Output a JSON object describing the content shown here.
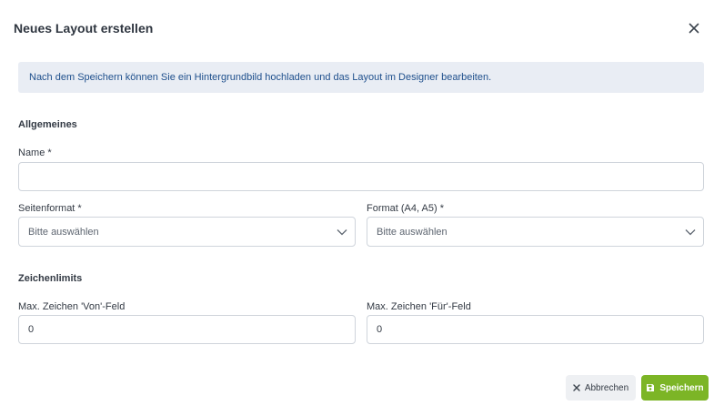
{
  "dialog": {
    "title": "Neues Layout erstellen",
    "close_icon": "close-icon"
  },
  "info": {
    "message": "Nach dem Speichern können Sie ein Hintergrundbild hochladen und das Layout im Designer bearbeiten."
  },
  "general": {
    "title": "Allgemeines",
    "name_label": "Name *",
    "name_value": "",
    "page_format_label": "Seitenformat *",
    "page_format_placeholder": "Bitte auswählen",
    "format_label": "Format (A4, A5) *",
    "format_placeholder": "Bitte auswählen"
  },
  "limits": {
    "title": "Zeichenlimits",
    "from_label": "Max. Zeichen 'Von'-Feld",
    "from_value": "0",
    "to_label": "Max. Zeichen 'Für'-Feld",
    "to_value": "0"
  },
  "footer": {
    "cancel_label": "Abbrechen",
    "cancel_icon": "x-icon",
    "save_label": "Speichern",
    "save_icon": "save-icon"
  },
  "colors": {
    "accent_green": "#7cb526",
    "info_bg": "#e9edf4",
    "info_text": "#1e4f8c"
  }
}
